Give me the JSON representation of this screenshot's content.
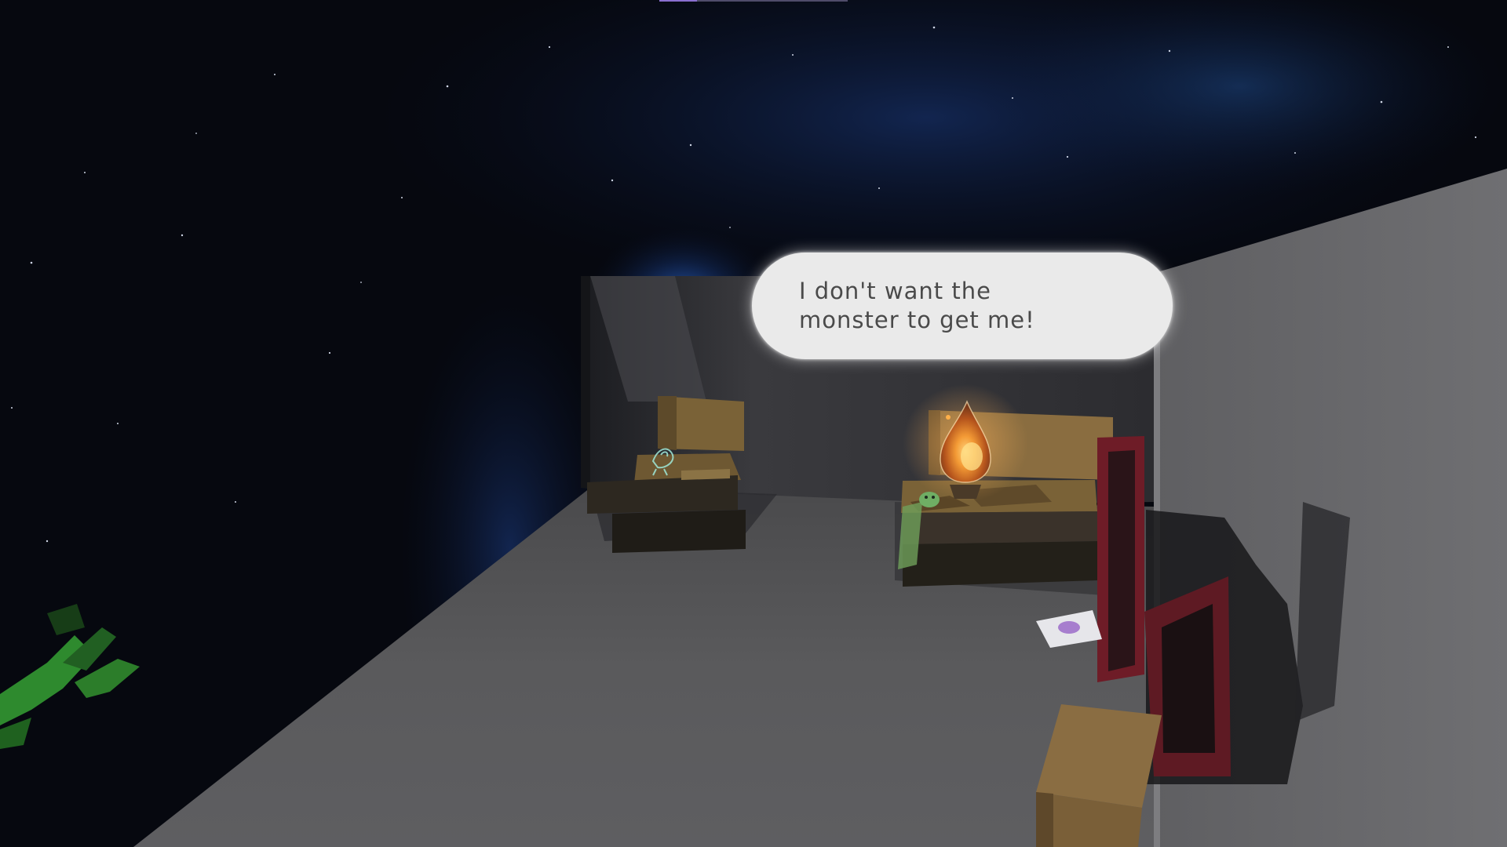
{
  "dialogue": {
    "lines": [
      "I don't want the",
      "monster to get me!"
    ]
  },
  "scene": {
    "setting": "night-sky-room",
    "objects": [
      "wall",
      "floor",
      "back-wall",
      "bed-left",
      "bed-right",
      "flame-spirit",
      "ghost-figure",
      "picture-frame",
      "cardboard-box",
      "green-plant",
      "paper-drawing"
    ]
  },
  "colors": {
    "sky": "#05070d",
    "nebula": "#1f4fa8",
    "floor": "#5b5b5d",
    "wall": "#6b6b6e",
    "bed": "#7a6237",
    "frame": "#6e1c27",
    "box": "#8a6d42",
    "plant": "#2e8a2e",
    "flame": "#f08a2a",
    "bubble": "#eaeaea",
    "bubble_text": "#4a4a4a"
  }
}
